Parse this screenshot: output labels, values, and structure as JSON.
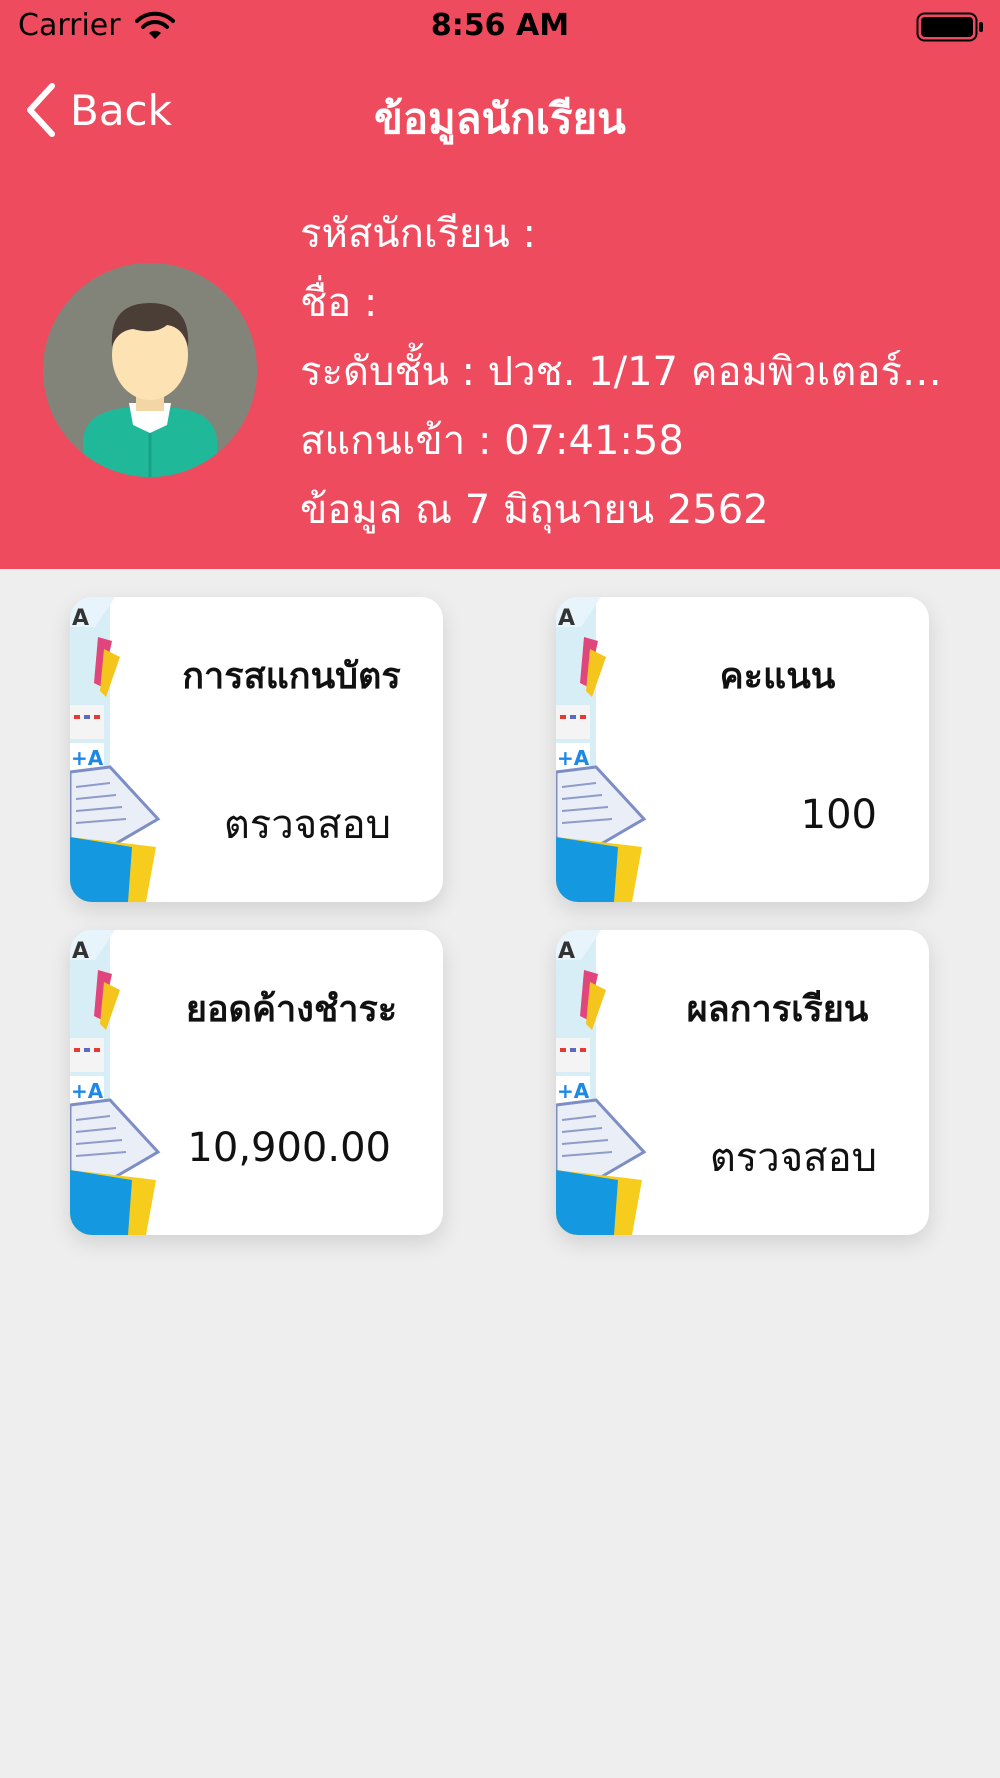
{
  "status_bar": {
    "carrier": "Carrier",
    "time": "8:56 AM"
  },
  "nav": {
    "back_label": "Back",
    "title": "ข้อมูลนักเรียน"
  },
  "student": {
    "id_line": "รหัสนักเรียน :",
    "name_line": "ชื่อ :",
    "level_line": "ระดับชั้น : ปวช. 1/17 คอมพิวเตอร์ก...",
    "scan_line": "สแกนเข้า : 07:41:58",
    "date_line": "ข้อมูล ณ 7 มิถุนายน 2562"
  },
  "cards": [
    {
      "title": "การสแกนบัตร",
      "value": "ตรวจสอบ"
    },
    {
      "title": "คะแนน",
      "value": "100"
    },
    {
      "title": "ยอดค้างชำระ",
      "value": "10,900.00"
    },
    {
      "title": "ผลการเรียน",
      "value": "ตรวจสอบ"
    }
  ],
  "colors": {
    "header": "#ef4b5e",
    "background": "#eeeeee"
  }
}
